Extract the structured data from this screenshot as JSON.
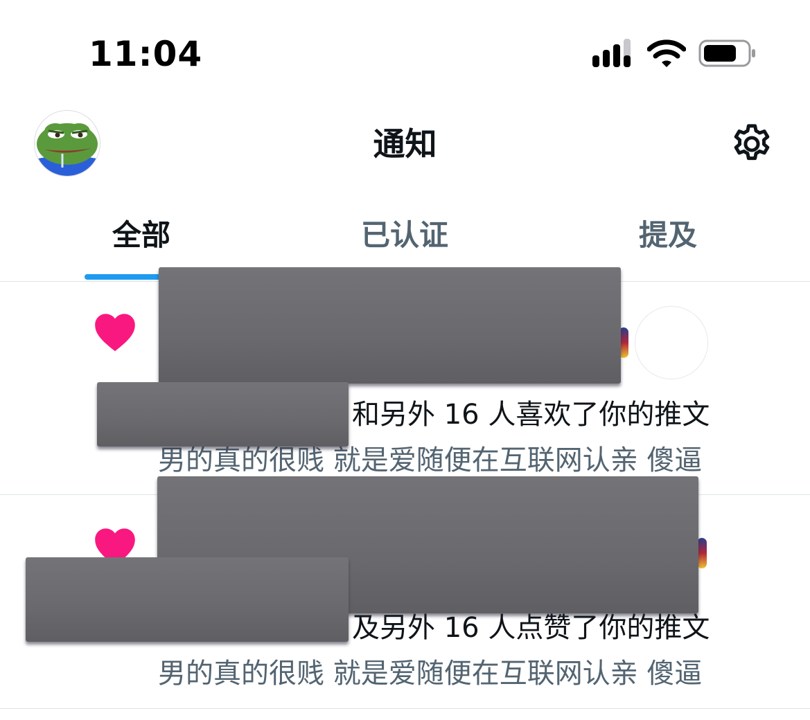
{
  "status_bar": {
    "time": "11:04"
  },
  "header": {
    "title": "通知",
    "settings_icon": "gear-icon"
  },
  "tabs": [
    {
      "label": "全部",
      "active": true
    },
    {
      "label": "已认证",
      "active": false
    },
    {
      "label": "提及",
      "active": false
    }
  ],
  "colors": {
    "accent": "#1d9bf0",
    "like": "#f91880",
    "primary_text": "#0f1419",
    "secondary_text": "#536471"
  },
  "notifications": [
    {
      "icon": "heart-icon",
      "text": "和另外 16 人喜欢了你的推文",
      "preview": "男的真的很贱 就是爱随便在互联网认亲 傻逼"
    },
    {
      "icon": "heart-icon",
      "text": "及另外 16 人点赞了你的推文",
      "preview": "男的真的很贱 就是爱随便在互联网认亲 傻逼"
    }
  ]
}
